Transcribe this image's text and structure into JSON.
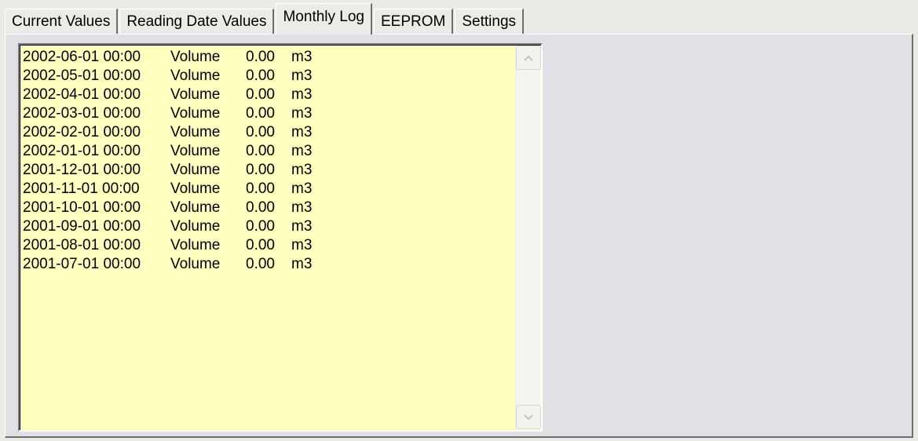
{
  "tabs": [
    {
      "label": "Current Values",
      "active": false
    },
    {
      "label": "Reading Date Values",
      "active": false
    },
    {
      "label": "Monthly Log",
      "active": true
    },
    {
      "label": "EEPROM",
      "active": false
    },
    {
      "label": "Settings",
      "active": false
    }
  ],
  "log": {
    "rows": [
      {
        "datetime": "2002-06-01 00:00",
        "label": "Volume",
        "value": "0.00",
        "unit": "m3"
      },
      {
        "datetime": "2002-05-01 00:00",
        "label": "Volume",
        "value": "0.00",
        "unit": "m3"
      },
      {
        "datetime": "2002-04-01 00:00",
        "label": "Volume",
        "value": "0.00",
        "unit": "m3"
      },
      {
        "datetime": "2002-03-01 00:00",
        "label": "Volume",
        "value": "0.00",
        "unit": "m3"
      },
      {
        "datetime": "2002-02-01 00:00",
        "label": "Volume",
        "value": "0.00",
        "unit": "m3"
      },
      {
        "datetime": "2002-01-01 00:00",
        "label": "Volume",
        "value": "0.00",
        "unit": "m3"
      },
      {
        "datetime": "2001-12-01 00:00",
        "label": "Volume",
        "value": "0.00",
        "unit": "m3"
      },
      {
        "datetime": "2001-11-01 00:00",
        "label": "Volume",
        "value": "0.00",
        "unit": "m3"
      },
      {
        "datetime": "2001-10-01 00:00",
        "label": "Volume",
        "value": "0.00",
        "unit": "m3"
      },
      {
        "datetime": "2001-09-01 00:00",
        "label": "Volume",
        "value": "0.00",
        "unit": "m3"
      },
      {
        "datetime": "2001-08-01 00:00",
        "label": "Volume",
        "value": "0.00",
        "unit": "m3"
      },
      {
        "datetime": "2001-07-01 00:00",
        "label": "Volume",
        "value": "0.00",
        "unit": "m3"
      }
    ]
  },
  "scrollbar": {
    "up_icon": "chevron-up-icon",
    "down_icon": "chevron-down-icon"
  },
  "colors": {
    "list_background": "#FFFFC0",
    "panel_background": "#E1E0E4"
  }
}
